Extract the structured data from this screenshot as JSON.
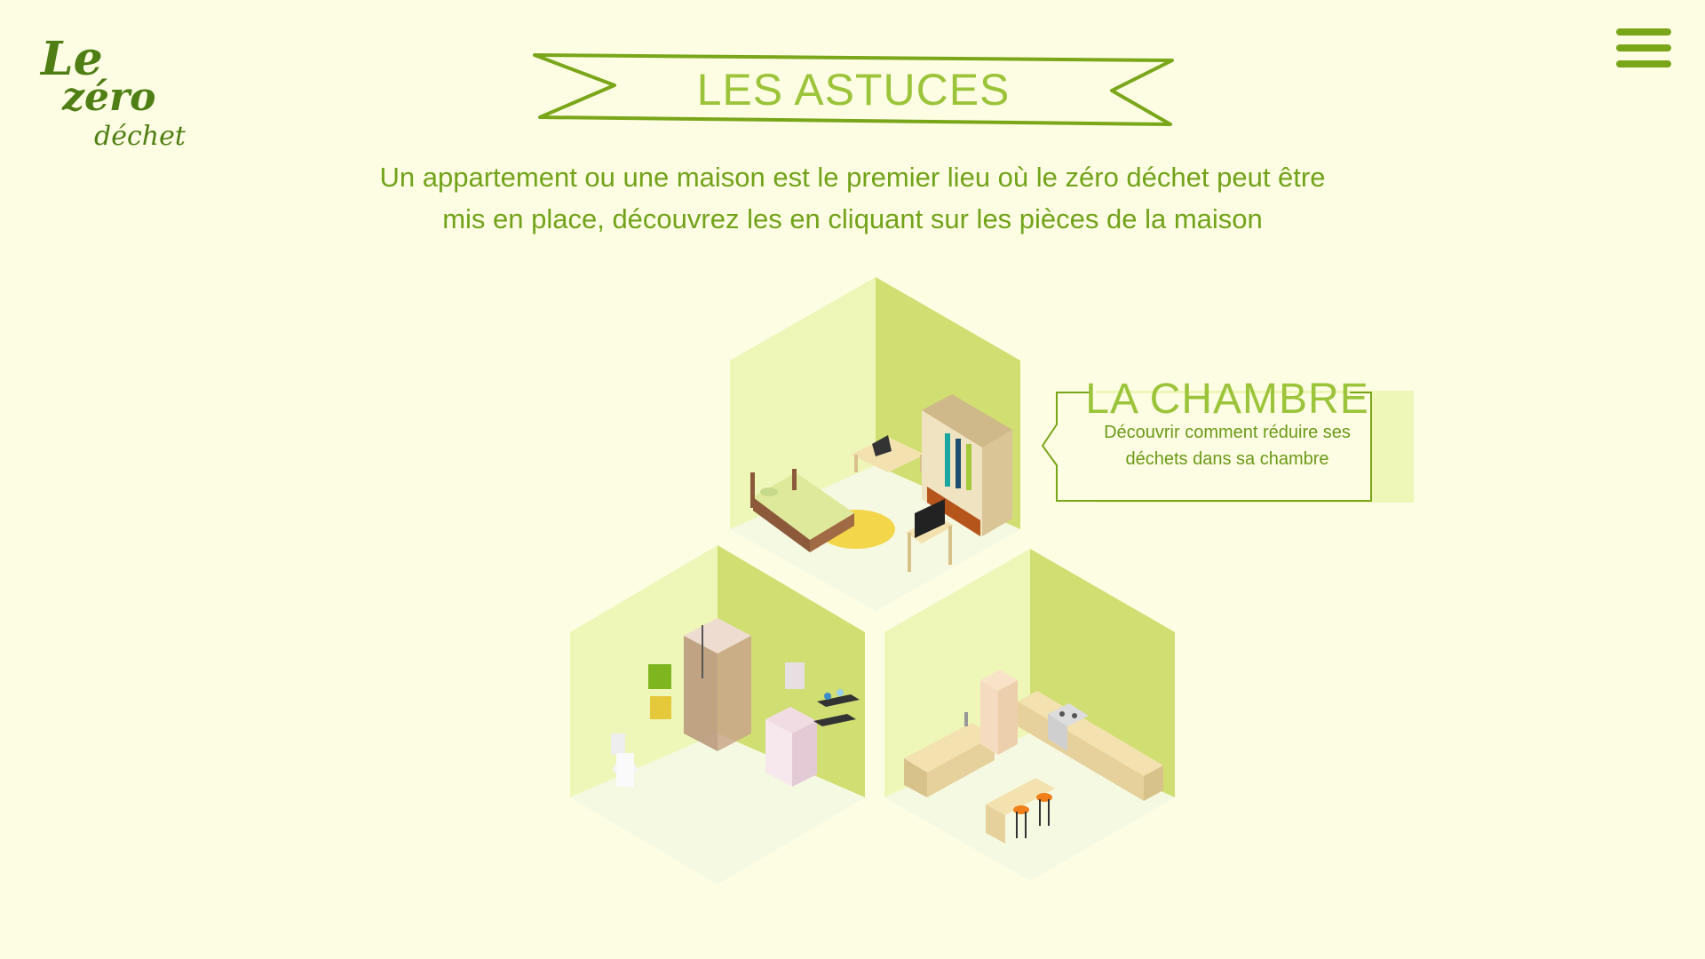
{
  "header": {
    "logo_line1": "Le",
    "logo_line2": "zéro",
    "logo_line3": "déchet",
    "menu_icon": "hamburger-menu-icon"
  },
  "page": {
    "title": "LES ASTUCES",
    "intro_line1": "Un appartement ou une maison est le premier lieu où le zéro déchet peut être",
    "intro_line2": "mis en place, découvrez les en cliquant sur les pièces de la maison"
  },
  "callout": {
    "title": "LA CHAMBRE",
    "text": "Découvrir comment réduire ses déchets dans sa chambre"
  },
  "colors": {
    "background": "#fdfde3",
    "accent": "#7aa61a",
    "light_wall": "#eef6b8",
    "dark_wall": "#d1de72",
    "floor": "#f5f9e2"
  }
}
